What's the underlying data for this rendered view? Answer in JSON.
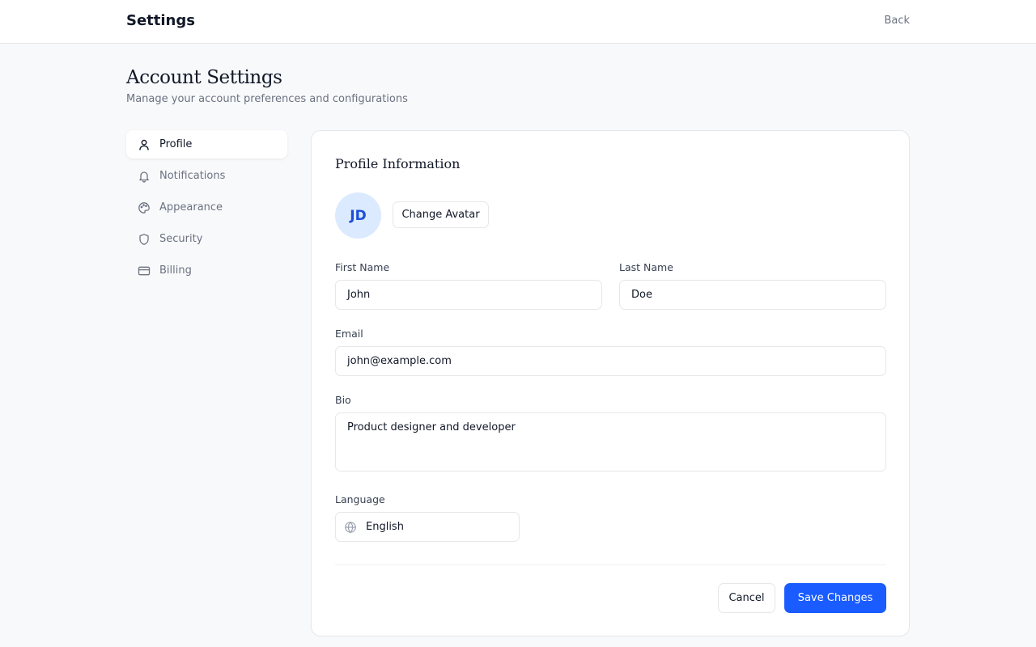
{
  "header": {
    "app_title": "Settings",
    "back_label": "Back"
  },
  "page": {
    "title": "Account Settings",
    "subtitle": "Manage your account preferences and configurations"
  },
  "sidebar": {
    "items": [
      {
        "label": "Profile",
        "icon": "user-icon",
        "active": true
      },
      {
        "label": "Notifications",
        "icon": "bell-icon",
        "active": false
      },
      {
        "label": "Appearance",
        "icon": "palette-icon",
        "active": false
      },
      {
        "label": "Security",
        "icon": "shield-icon",
        "active": false
      },
      {
        "label": "Billing",
        "icon": "credit-card-icon",
        "active": false
      }
    ]
  },
  "profile": {
    "title": "Profile Information",
    "avatar_initials": "JD",
    "change_avatar_label": "Change Avatar",
    "first_name_label": "First Name",
    "first_name_value": "John",
    "last_name_label": "Last Name",
    "last_name_value": "Doe",
    "email_label": "Email",
    "email_value": "john@example.com",
    "bio_label": "Bio",
    "bio_value": "Product designer and developer",
    "language_label": "Language",
    "language_value": "English",
    "language_icon": "globe-icon"
  },
  "actions": {
    "cancel_label": "Cancel",
    "save_label": "Save Changes"
  },
  "colors": {
    "accent": "#1a5cff",
    "avatar_bg": "#dbeafe",
    "avatar_text": "#1d4ed8"
  }
}
